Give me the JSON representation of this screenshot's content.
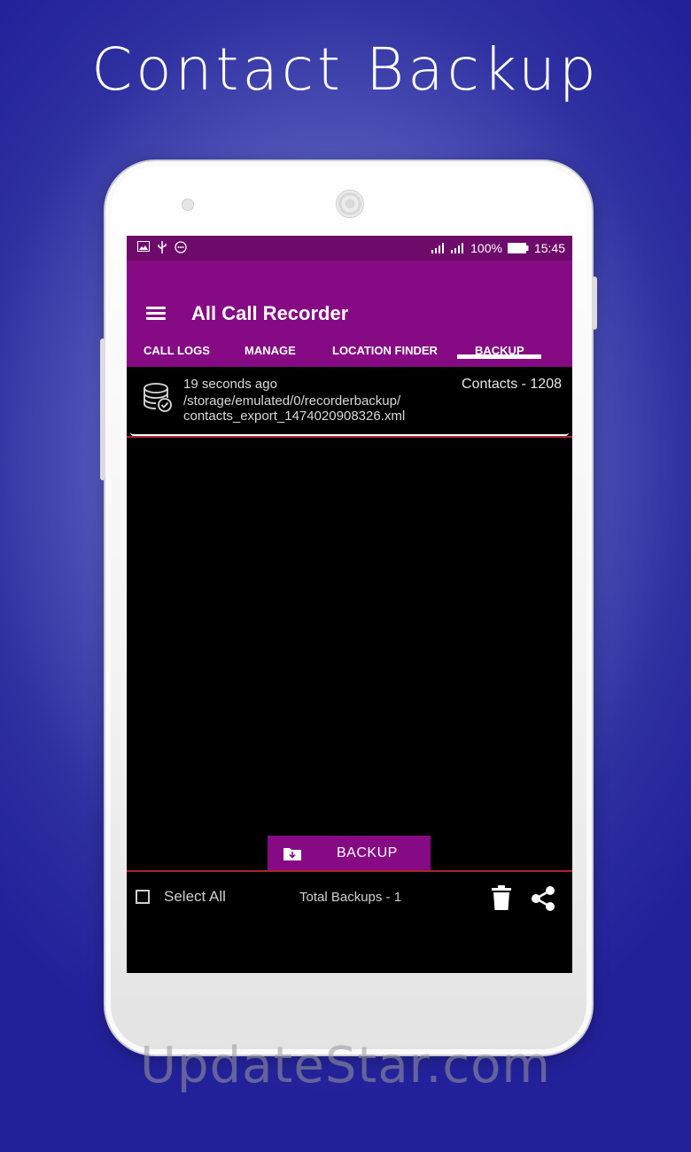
{
  "headline": "Contact Backup",
  "status_bar": {
    "battery": "100%",
    "time": "15:45",
    "left_icons": [
      "image-icon",
      "usb-icon",
      "chat-icon"
    ],
    "right_icons": [
      "signal-icon",
      "signal-icon",
      "battery-icon"
    ]
  },
  "app": {
    "title": "All Call Recorder",
    "tabs": [
      {
        "label": "CALL LOGS",
        "active": false
      },
      {
        "label": "MANAGE",
        "active": false
      },
      {
        "label": "LOCATION FINDER",
        "active": false
      },
      {
        "label": "BACKUP",
        "active": true
      }
    ]
  },
  "backups": [
    {
      "time": "19 seconds ago",
      "path_line1": "/storage/emulated/0/recorderbackup/",
      "path_line2": "contacts_export_1474020908326.xml",
      "contacts": "Contacts - 1208",
      "icon": "database-check-icon"
    }
  ],
  "backup_button": {
    "label": "BACKUP",
    "icon": "folder-download-icon"
  },
  "footer": {
    "select_all": "Select All",
    "total": "Total Backups - 1",
    "icons": [
      "trash-icon",
      "share-icon"
    ]
  },
  "watermark": "UpdateStar.com",
  "colors": {
    "app_bar": "#850a83",
    "status_bar": "#6d0a6a",
    "divider": "#b0202c",
    "background": "#000000"
  }
}
